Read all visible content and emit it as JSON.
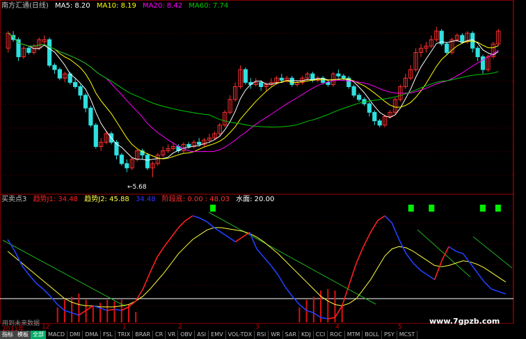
{
  "header": {
    "title": "南方汇通(日线)",
    "ma5": "MA5: 8.20",
    "ma10": "MA10: 8.19",
    "ma20": "MA20: 8.42",
    "ma60": "MA60: 7.74",
    "colors": {
      "ma5": "#ffffff",
      "ma10": "#ffff00",
      "ma20": "#ff00ff",
      "ma60": "#00cc00"
    }
  },
  "indicator_header": {
    "name": "买卖点3",
    "j1": "趋势J1: 34.48",
    "j2": "趋势J2: 45.88",
    "dash": "- ",
    "blue": "34.48",
    "stage": "阶段底: 0.00 : 48.03",
    "water": "水面: 20.00"
  },
  "low_label": "←5.68",
  "x_labels": [
    "2011年",
    "12",
    "1",
    "2",
    "3",
    "4",
    "5"
  ],
  "tabs": {
    "cat1": "指标",
    "cat2": "模板",
    "cat3": "全部",
    "items": [
      "MACD",
      "DMI",
      "DMA",
      "FSL",
      "TRIX",
      "BRAR",
      "CR",
      "VR",
      "OBV",
      "ASI",
      "EMV",
      "VOL-TDX",
      "RSI",
      "WR",
      "SAR",
      "KDJ",
      "CCI",
      "ROC",
      "MTM",
      "BOLL",
      "PSY",
      "MCST"
    ]
  },
  "watermark": "www.7gpzb.com",
  "overlay_text": "用到未来数据",
  "chart_data": [
    {
      "type": "candlestick",
      "title": "南方汇通(日线)",
      "ylim": [
        5.3,
        9.6
      ],
      "candles": [
        [
          8.7,
          9.05,
          8.6,
          9.1
        ],
        [
          9.0,
          8.9,
          8.85,
          9.1
        ],
        [
          8.9,
          8.5,
          8.4,
          8.95
        ],
        [
          8.5,
          8.7,
          8.45,
          8.75
        ],
        [
          8.7,
          8.6,
          8.55,
          8.75
        ],
        [
          8.6,
          8.75,
          8.55,
          8.8
        ],
        [
          8.7,
          8.9,
          8.65,
          8.95
        ],
        [
          8.85,
          8.9,
          8.8,
          9.0
        ],
        [
          8.9,
          8.3,
          8.25,
          8.95
        ],
        [
          8.3,
          8.2,
          8.1,
          8.35
        ],
        [
          8.2,
          8.0,
          7.95,
          8.25
        ],
        [
          8.0,
          8.1,
          7.9,
          8.15
        ],
        [
          8.1,
          7.9,
          7.85,
          8.15
        ],
        [
          7.9,
          7.8,
          7.75,
          8.0
        ],
        [
          7.8,
          7.6,
          7.5,
          7.85
        ],
        [
          7.6,
          7.3,
          7.2,
          7.65
        ],
        [
          7.3,
          6.9,
          6.85,
          7.35
        ],
        [
          6.9,
          6.4,
          6.35,
          6.95
        ],
        [
          6.4,
          6.5,
          6.3,
          6.6
        ],
        [
          6.5,
          6.7,
          6.45,
          6.75
        ],
        [
          6.7,
          6.5,
          6.45,
          6.75
        ],
        [
          6.5,
          6.2,
          6.1,
          6.55
        ],
        [
          6.2,
          6.0,
          5.95,
          6.25
        ],
        [
          6.0,
          5.9,
          5.8,
          6.1
        ],
        [
          5.9,
          6.1,
          5.85,
          6.15
        ],
        [
          6.1,
          6.3,
          6.05,
          6.35
        ],
        [
          6.3,
          6.2,
          6.1,
          6.35
        ],
        [
          6.2,
          5.9,
          5.85,
          6.25
        ],
        [
          5.9,
          6.0,
          5.68,
          6.05
        ],
        [
          6.0,
          6.2,
          5.95,
          6.25
        ],
        [
          6.2,
          6.3,
          6.15,
          6.4
        ],
        [
          6.3,
          6.35,
          6.25,
          6.45
        ],
        [
          6.35,
          6.4,
          6.3,
          6.5
        ],
        [
          6.4,
          6.3,
          6.25,
          6.45
        ],
        [
          6.3,
          6.45,
          6.25,
          6.5
        ],
        [
          6.45,
          6.4,
          6.35,
          6.5
        ],
        [
          6.4,
          6.5,
          6.35,
          6.55
        ],
        [
          6.5,
          6.45,
          6.4,
          6.6
        ],
        [
          6.45,
          6.55,
          6.4,
          6.6
        ],
        [
          6.55,
          6.6,
          6.5,
          6.7
        ],
        [
          6.6,
          6.7,
          6.55,
          6.75
        ],
        [
          6.7,
          6.9,
          6.65,
          6.95
        ],
        [
          6.9,
          7.2,
          6.85,
          7.25
        ],
        [
          7.2,
          7.5,
          7.15,
          7.6
        ],
        [
          7.5,
          7.8,
          7.45,
          7.9
        ],
        [
          7.8,
          8.2,
          7.75,
          8.3
        ],
        [
          8.2,
          7.9,
          7.85,
          8.25
        ],
        [
          7.9,
          7.85,
          7.75,
          8.0
        ],
        [
          7.85,
          7.9,
          7.8,
          8.0
        ],
        [
          7.9,
          7.8,
          7.7,
          7.95
        ],
        [
          7.8,
          7.85,
          7.7,
          7.9
        ],
        [
          7.85,
          7.9,
          7.8,
          8.0
        ],
        [
          7.9,
          8.0,
          7.85,
          8.05
        ],
        [
          8.0,
          7.95,
          7.9,
          8.1
        ],
        [
          7.95,
          8.0,
          7.9,
          8.05
        ],
        [
          8.0,
          7.85,
          7.8,
          8.05
        ],
        [
          7.85,
          7.9,
          7.8,
          7.95
        ],
        [
          7.9,
          8.0,
          7.85,
          8.05
        ],
        [
          8.0,
          8.1,
          7.95,
          8.15
        ],
        [
          8.1,
          7.95,
          7.9,
          8.15
        ],
        [
          7.95,
          8.0,
          7.9,
          8.05
        ],
        [
          8.0,
          7.9,
          7.85,
          8.05
        ],
        [
          7.9,
          7.85,
          7.8,
          7.95
        ],
        [
          7.85,
          8.1,
          7.8,
          8.15
        ],
        [
          8.1,
          8.05,
          8.0,
          8.2
        ],
        [
          8.05,
          8.0,
          7.95,
          8.1
        ],
        [
          8.0,
          7.8,
          7.75,
          8.05
        ],
        [
          7.8,
          7.6,
          7.55,
          7.85
        ],
        [
          7.6,
          7.5,
          7.45,
          7.65
        ],
        [
          7.5,
          7.4,
          7.35,
          7.55
        ],
        [
          7.4,
          7.2,
          7.1,
          7.45
        ],
        [
          7.2,
          7.0,
          6.9,
          7.25
        ],
        [
          7.0,
          6.9,
          6.85,
          7.05
        ],
        [
          6.9,
          7.1,
          6.85,
          7.15
        ],
        [
          7.1,
          7.2,
          7.05,
          7.25
        ],
        [
          7.2,
          7.5,
          7.15,
          7.55
        ],
        [
          7.5,
          7.8,
          7.45,
          7.85
        ],
        [
          7.8,
          8.0,
          7.75,
          8.1
        ],
        [
          8.0,
          8.2,
          7.95,
          8.3
        ],
        [
          8.2,
          8.6,
          8.15,
          8.7
        ],
        [
          8.6,
          8.7,
          8.5,
          8.8
        ],
        [
          8.7,
          8.75,
          8.6,
          8.85
        ],
        [
          8.75,
          8.9,
          8.7,
          9.0
        ],
        [
          8.9,
          9.1,
          8.85,
          9.2
        ],
        [
          9.1,
          8.8,
          8.75,
          9.15
        ],
        [
          8.8,
          8.6,
          8.55,
          8.85
        ],
        [
          8.6,
          8.9,
          8.55,
          8.95
        ],
        [
          8.9,
          9.0,
          8.85,
          9.05
        ],
        [
          9.0,
          8.85,
          8.8,
          9.05
        ],
        [
          8.85,
          9.05,
          8.8,
          9.1
        ],
        [
          9.05,
          8.7,
          8.6,
          9.1
        ],
        [
          8.7,
          8.5,
          8.4,
          8.75
        ],
        [
          8.5,
          8.2,
          8.1,
          8.55
        ],
        [
          8.2,
          8.5,
          8.15,
          8.55
        ],
        [
          8.5,
          8.8,
          8.45,
          8.85
        ],
        [
          8.8,
          9.1,
          8.75,
          9.15
        ]
      ],
      "ma_series": [
        "MA5",
        "MA10",
        "MA20",
        "MA60"
      ],
      "annotations": [
        "←5.68"
      ]
    },
    {
      "type": "line",
      "title": "买卖点3",
      "ylim": [
        0,
        100
      ],
      "series": [
        {
          "name": "趋势J1",
          "color": "#ff2020",
          "values": [
            70,
            60,
            48,
            40,
            33,
            28,
            22,
            15,
            10,
            8,
            6,
            10,
            14,
            12,
            10,
            11,
            10,
            13,
            18,
            28,
            42,
            55,
            64,
            72,
            80,
            86,
            90,
            88,
            85,
            80,
            76,
            72,
            68,
            72,
            76,
            62,
            55,
            48,
            40,
            30,
            22,
            15,
            10,
            8,
            4,
            3,
            4,
            14,
            32,
            50,
            64,
            76,
            86,
            90,
            84,
            70,
            58,
            50,
            44,
            40,
            36,
            52,
            64,
            60,
            58,
            50,
            42,
            34,
            28,
            26,
            24
          ]
        },
        {
          "name": "趋势J2",
          "color": "#ffff40",
          "values": [
            60,
            55,
            50,
            45,
            40,
            35,
            30,
            25,
            20,
            17,
            15,
            14,
            14,
            13,
            13,
            13,
            14,
            15,
            18,
            22,
            28,
            35,
            42,
            50,
            58,
            64,
            70,
            74,
            78,
            80,
            80,
            79,
            78,
            77,
            75,
            72,
            68,
            63,
            58,
            52,
            46,
            40,
            34,
            28,
            22,
            18,
            15,
            14,
            16,
            20,
            28,
            36,
            46,
            56,
            62,
            64,
            63,
            60,
            56,
            52,
            48,
            47,
            48,
            50,
            52,
            51,
            49,
            46,
            42,
            38,
            34
          ]
        }
      ],
      "signals": [
        80,
        84,
        94,
        97
      ],
      "water_level": 20
    }
  ]
}
